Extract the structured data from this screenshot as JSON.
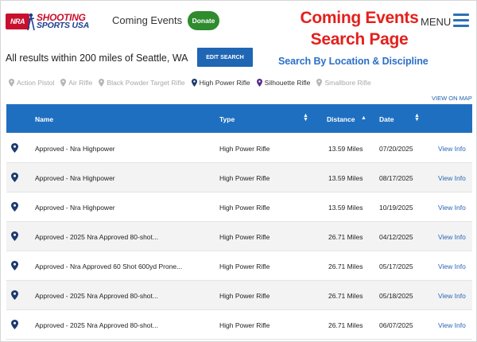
{
  "header": {
    "logo_nra": "NRA",
    "logo_line1": "SHOOTING",
    "logo_line2": "SPORTS USA",
    "nav_coming_events": "Coming Events",
    "donate_label": "Donate",
    "menu_label": "MENU"
  },
  "overlay": {
    "title_line1": "Coming Events",
    "title_line2": "Search Page",
    "subtitle": "Search By Location & Discipline"
  },
  "search": {
    "results_text": "All results within 200 miles of Seattle, WA",
    "edit_button": "EDIT SEARCH",
    "view_on_map": "VIEW ON MAP"
  },
  "filters": [
    {
      "label": "Action Pistol",
      "active": false,
      "color": "#b5b5b5"
    },
    {
      "label": "Air Rifle",
      "active": false,
      "color": "#b5b5b5"
    },
    {
      "label": "Black Powder Target Rifle",
      "active": false,
      "color": "#b5b5b5"
    },
    {
      "label": "High Power Rifle",
      "active": true,
      "color": "#1c3a6e"
    },
    {
      "label": "Silhouette Rifle",
      "active": true,
      "color": "#5a2a8a"
    },
    {
      "label": "Smallbore Rifle",
      "active": false,
      "color": "#b5b5b5"
    }
  ],
  "table": {
    "columns": {
      "name": "Name",
      "type": "Type",
      "distance": "Distance",
      "date": "Date"
    },
    "rows": [
      {
        "name": "Approved - Nra Highpower",
        "type": "High Power Rifle",
        "distance": "13.59 Miles",
        "date": "07/20/2025",
        "action": "View Info"
      },
      {
        "name": "Approved - Nra Highpower",
        "type": "High Power Rifle",
        "distance": "13.59 Miles",
        "date": "08/17/2025",
        "action": "View Info"
      },
      {
        "name": "Approved - Nra Highpower",
        "type": "High Power Rifle",
        "distance": "13.59 Miles",
        "date": "10/19/2025",
        "action": "View Info"
      },
      {
        "name": "Approved - 2025 Nra Approved 80-shot...",
        "type": "High Power Rifle",
        "distance": "26.71 Miles",
        "date": "04/12/2025",
        "action": "View Info"
      },
      {
        "name": "Approved - Nra Approved 60 Shot 600yd Prone...",
        "type": "High Power Rifle",
        "distance": "26.71 Miles",
        "date": "05/17/2025",
        "action": "View Info"
      },
      {
        "name": "Approved - 2025 Nra Approved 80-shot...",
        "type": "High Power Rifle",
        "distance": "26.71 Miles",
        "date": "05/18/2025",
        "action": "View Info"
      },
      {
        "name": "Approved - 2025 Nra Approved 80-shot...",
        "type": "High Power Rifle",
        "distance": "26.71 Miles",
        "date": "06/07/2025",
        "action": "View Info"
      }
    ]
  },
  "colors": {
    "brand_red": "#c8102e",
    "brand_blue": "#1f6fc0",
    "donate_green": "#2e8b2e",
    "pin_navy": "#1c3a6e"
  }
}
